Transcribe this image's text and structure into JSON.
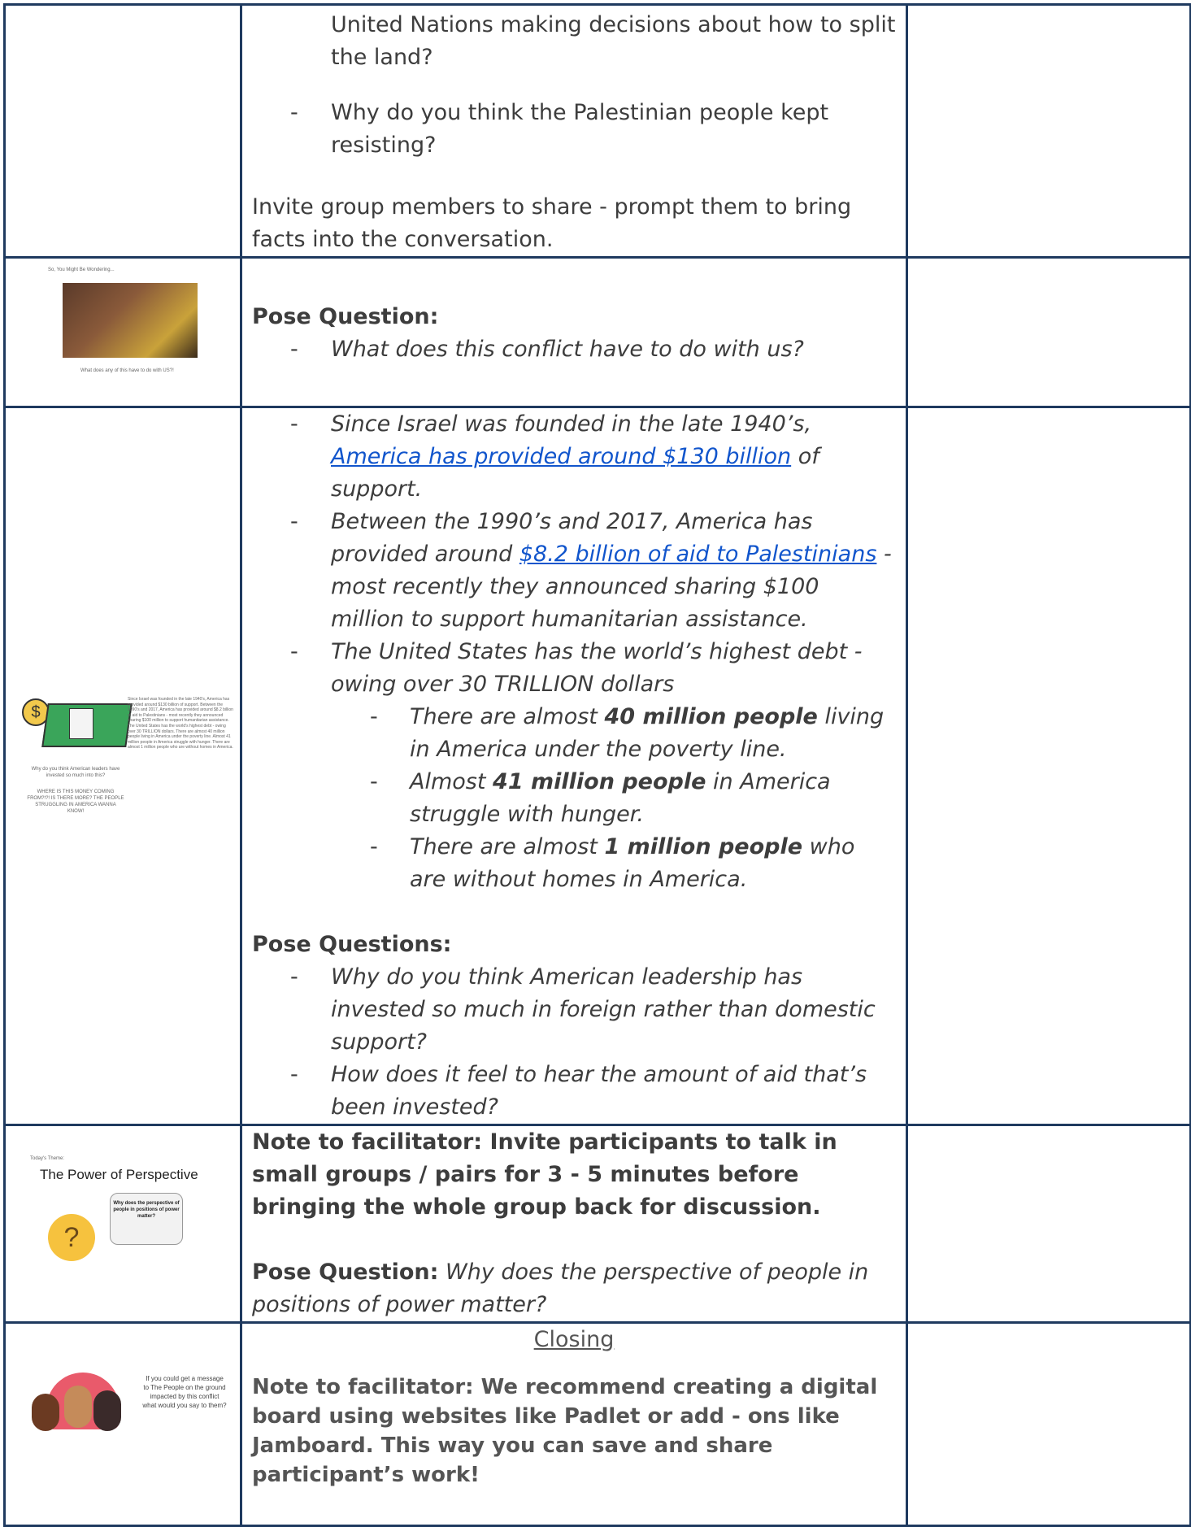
{
  "row1": {
    "lines": [
      "United Nations making decisions about how to split the land?",
      "Why do you think the Palestinian people kept resisting?",
      "Invite group members to share - prompt them to bring facts into the conversation."
    ]
  },
  "row2": {
    "thumb_title": "So, You Might Be Wondering...",
    "thumb_caption": "What does any of this have to do with US?!",
    "pose_label": "Pose Question:",
    "question": "What does this conflict have to do with us?"
  },
  "row3": {
    "b1_pre": "Since Israel was founded in the late 1940’s,",
    "b1_link": "America has provided around $130 billion",
    "b1_post": "of support.",
    "b2_pre": "Between the 1990’s and 2017, America has provided around",
    "b2_link": "$8.2 billion of aid to Palestinians",
    "b2_post": "- most recently they announced sharing $100 million to support humanitarian assistance.",
    "b3": "The United States has the world’s highest debt - owing over 30 TRILLION dollars",
    "s1_pre": "There are almost",
    "s1_bold": "40 million people",
    "s1_post": "living in America under the poverty line.",
    "s2_pre": "Almost",
    "s2_bold": "41 million people",
    "s2_post": "in America struggle with hunger.",
    "s3_pre": "There are almost",
    "s3_bold": "1 million people",
    "s3_post": "who are without homes in America.",
    "pose_label": "Pose Questions:",
    "q1": "Why do you think American leadership has invested so much in foreign rather than domestic support?",
    "q2": "How does it feel to hear the amount of aid that’s been invested?",
    "thumb_left1": "Why do you think American leaders have invested so much into this?",
    "thumb_left2": "WHERE IS THIS MONEY COMING FROM?!?! IS THERE MORE? THE PEOPLE STRUGGLING IN AMERICA WANNA KNOW!",
    "thumb_right": "Since Israel was founded in the late 1940's, America has provided around $130 billion of support. Between the 1990's and 2017, America has provided around $8.2 billion of aid to Palestinians - most recently they announced sharing $100 million to support humanitarian assistance. The United States has the world's highest debt - owing over 30 TRILLION dollars. There are almost 40 million people living in America under the poverty line. Almost 41 million people in America struggle with hunger. There are almost 1 million people who are without homes in America."
  },
  "row4": {
    "thumb_theme": "Today's Theme:",
    "thumb_title": "The Power of Perspective",
    "thumb_bubble": "Why does the perspective of people in positions of power matter?",
    "note": "Note to facilitator: Invite participants to talk in small groups / pairs for 3 - 5 minutes before bringing the whole group back for discussion.",
    "pose_label": "Pose Question:",
    "question": "Why does the perspective of people in positions of power matter?"
  },
  "row5": {
    "thumb_text": "If you could get a message to The People on the ground impacted by this conflict what would you say to them?",
    "closing": "Closing",
    "note": "Note to facilitator: We recommend creating a digital board using websites like Padlet or add - ons like Jamboard. This way you can save and share participant’s work!"
  },
  "colors": {
    "border": "#1f3a5f",
    "link": "#1155cc",
    "text": "#3d3d3d"
  }
}
